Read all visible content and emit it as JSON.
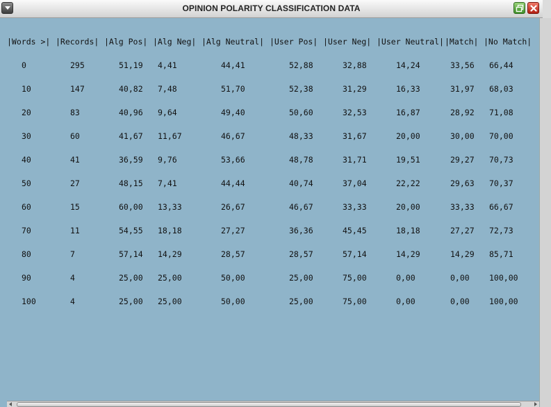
{
  "window": {
    "title": "OPINION POLARITY CLASSIFICATION DATA"
  },
  "table": {
    "headers": [
      "|Words >|",
      "|Records|",
      "|Alg Pos|",
      "|Alg Neg|",
      "|Alg Neutral|",
      "|User Pos|",
      "|User Neg|",
      "|User Neutral|",
      "|Match|",
      "|No Match|"
    ],
    "rows": [
      [
        "0",
        "295",
        "51,19",
        "4,41",
        "44,41",
        "52,88",
        "32,88",
        "14,24",
        "33,56",
        "66,44"
      ],
      [
        "10",
        "147",
        "40,82",
        "7,48",
        "51,70",
        "52,38",
        "31,29",
        "16,33",
        "31,97",
        "68,03"
      ],
      [
        "20",
        "83",
        "40,96",
        "9,64",
        "49,40",
        "50,60",
        "32,53",
        "16,87",
        "28,92",
        "71,08"
      ],
      [
        "30",
        "60",
        "41,67",
        "11,67",
        "46,67",
        "48,33",
        "31,67",
        "20,00",
        "30,00",
        "70,00"
      ],
      [
        "40",
        "41",
        "36,59",
        "9,76",
        "53,66",
        "48,78",
        "31,71",
        "19,51",
        "29,27",
        "70,73"
      ],
      [
        "50",
        "27",
        "48,15",
        "7,41",
        "44,44",
        "40,74",
        "37,04",
        "22,22",
        "29,63",
        "70,37"
      ],
      [
        "60",
        "15",
        "60,00",
        "13,33",
        "26,67",
        "46,67",
        "33,33",
        "20,00",
        "33,33",
        "66,67"
      ],
      [
        "70",
        "11",
        "54,55",
        "18,18",
        "27,27",
        "36,36",
        "45,45",
        "18,18",
        "27,27",
        "72,73"
      ],
      [
        "80",
        "7",
        "57,14",
        "14,29",
        "28,57",
        "28,57",
        "57,14",
        "14,29",
        "14,29",
        "85,71"
      ],
      [
        "90",
        "4",
        "25,00",
        "25,00",
        "50,00",
        "25,00",
        "75,00",
        "0,00",
        "0,00",
        "100,00"
      ],
      [
        "100",
        "4",
        "25,00",
        "25,00",
        "50,00",
        "25,00",
        "75,00",
        "0,00",
        "0,00",
        "100,00"
      ]
    ]
  },
  "colors": {
    "background": "#8fb4c9",
    "titlebar": "#e6e6e6",
    "close": "#c8301f",
    "restore": "#5aa83f"
  },
  "icons": {
    "menu": "chevron-down-icon",
    "restore": "restore-window-icon",
    "close": "close-icon"
  }
}
